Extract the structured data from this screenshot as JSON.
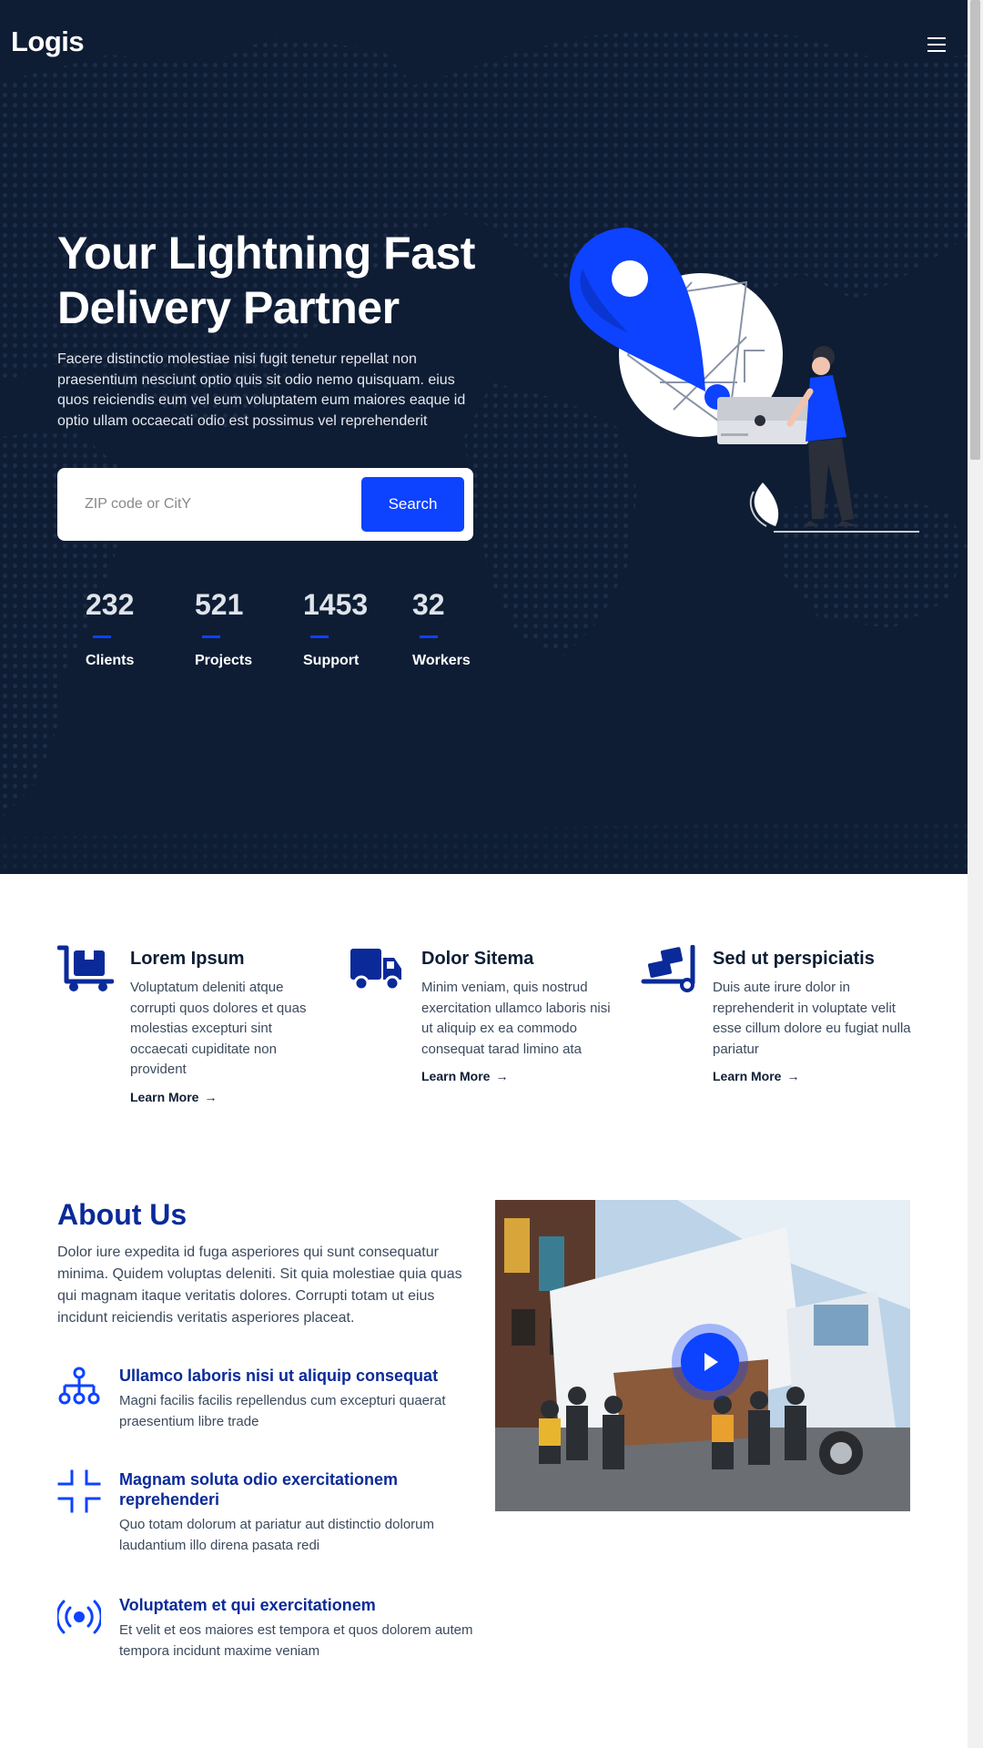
{
  "header": {
    "logo": "Logis",
    "menu_icon": "hamburger-icon"
  },
  "hero": {
    "title": "Your Lightning Fast Delivery Partner",
    "text": "Facere distinctio molestiae nisi fugit tenetur repellat non praesentium nesciunt optio quis sit odio nemo quisquam. eius quos reiciendis eum vel eum voluptatem eum maiores eaque id optio ullam occaecati odio est possimus vel reprehenderit",
    "search": {
      "placeholder": "ZIP code or CitY",
      "value": "",
      "button_label": "Search"
    },
    "stats": [
      {
        "value": "232",
        "label": "Clients"
      },
      {
        "value": "521",
        "label": "Projects"
      },
      {
        "value": "1453",
        "label": "Support"
      },
      {
        "value": "32",
        "label": "Workers"
      }
    ]
  },
  "services": [
    {
      "icon": "cart-icon",
      "title": "Lorem Ipsum",
      "text": "Voluptatum deleniti atque corrupti quos dolores et quas molestias excepturi sint occaecati cupiditate non provident",
      "link": "Learn More"
    },
    {
      "icon": "truck-icon",
      "title": "Dolor Sitema",
      "text": "Minim veniam, quis nostrud exercitation ullamco laboris nisi ut aliquip ex ea commodo consequat tarad limino ata",
      "link": "Learn More"
    },
    {
      "icon": "dolly-icon",
      "title": "Sed ut perspiciatis",
      "text": "Duis aute irure dolor in reprehenderit in voluptate velit esse cillum dolore eu fugiat nulla pariatur",
      "link": "Learn More"
    }
  ],
  "about": {
    "title": "About Us",
    "text": "Dolor iure expedita id fuga asperiores qui sunt consequatur minima. Quidem voluptas deleniti. Sit quia molestiae quia quas qui magnam itaque veritatis dolores. Corrupti totam ut eius incidunt reiciendis veritatis asperiores placeat.",
    "features": [
      {
        "icon": "diagram-icon",
        "title": "Ullamco laboris nisi ut aliquip consequat",
        "text": "Magni facilis facilis repellendus cum excepturi quaerat praesentium libre trade"
      },
      {
        "icon": "fullscreen-exit-icon",
        "title": "Magnam soluta odio exercitationem reprehenderi",
        "text": "Quo totam dolorum at pariatur aut distinctio dolorum laudantium illo direna pasata redi"
      },
      {
        "icon": "broadcast-icon",
        "title": "Voluptatem et qui exercitationem",
        "text": "Et velit et eos maiores est tempora et quos dolorem autem tempora incidunt maxime veniam"
      }
    ],
    "video": {
      "play_icon": "play-icon"
    }
  },
  "colors": {
    "hero_bg": "#0e1d34",
    "accent": "#0d42ff",
    "heading_blue": "#0a2a99"
  }
}
